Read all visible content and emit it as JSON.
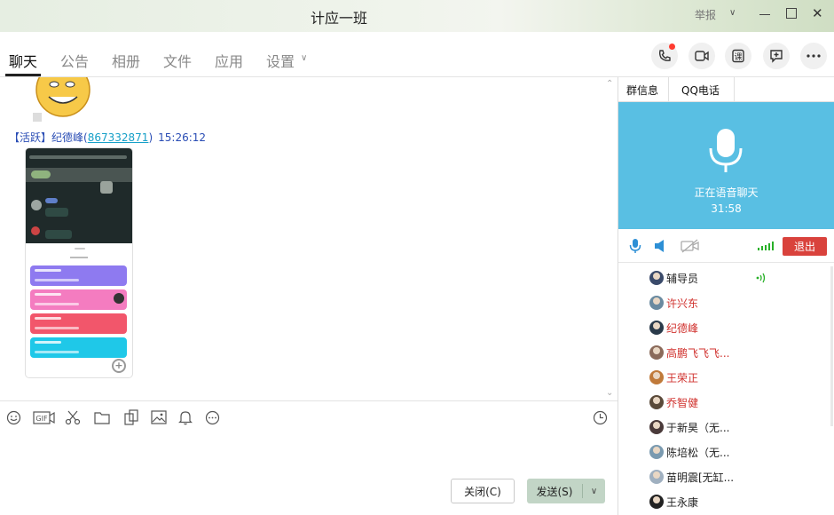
{
  "window": {
    "title": "计应一班",
    "report_label": "举报"
  },
  "tabs": [
    {
      "label": "聊天",
      "active": true
    },
    {
      "label": "公告"
    },
    {
      "label": "相册"
    },
    {
      "label": "文件"
    },
    {
      "label": "应用"
    },
    {
      "label": "设置"
    }
  ],
  "nav_icons": [
    "phone-call-icon",
    "video-call-icon",
    "class-icon",
    "add-message-icon",
    "more-icon"
  ],
  "message": {
    "role": "【活跃】",
    "sender": "纪德峰",
    "qq": "867332871",
    "time": "15:26:12"
  },
  "composer": {
    "tools": [
      "emoji-icon",
      "gif-icon",
      "scissors-icon",
      "folder-icon",
      "shake-icon",
      "image-icon",
      "bell-icon",
      "more-icon",
      "history-icon"
    ],
    "close_label": "关闭(C)",
    "send_label": "发送(S)"
  },
  "right_panel": {
    "tabs": [
      "群信息",
      "QQ电话"
    ],
    "voice_status": "正在语音聊天",
    "voice_time": "31:58",
    "exit_label": "退出",
    "members": [
      {
        "name": "辅导员",
        "color": "#222222",
        "speaking": true
      },
      {
        "name": "许兴东",
        "color": "#d0312d"
      },
      {
        "name": "纪德峰",
        "color": "#d0312d"
      },
      {
        "name": "高鹏飞飞飞...",
        "color": "#d0312d"
      },
      {
        "name": "王荣正",
        "color": "#d0312d"
      },
      {
        "name": "乔智健",
        "color": "#d0312d"
      },
      {
        "name": "于新昊（无...",
        "color": "#222222"
      },
      {
        "name": "陈培松（无...",
        "color": "#222222"
      },
      {
        "name": "苗明震[无缸...",
        "color": "#222222"
      },
      {
        "name": "王永康",
        "color": "#222222"
      }
    ]
  },
  "colors": {
    "voice_bg": "#59bfe3",
    "exit": "#d9423c",
    "send_bg": "#c2d5c6",
    "link": "#2a4db5"
  }
}
